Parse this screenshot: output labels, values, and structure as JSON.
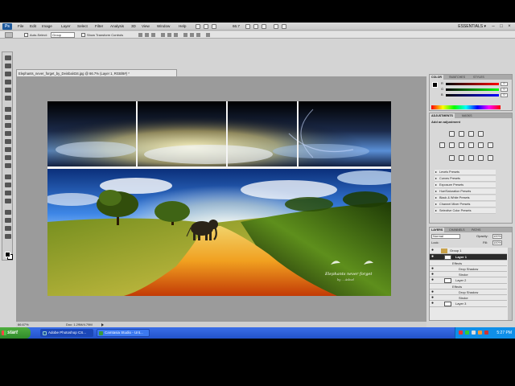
{
  "app": {
    "logo_text": "Ps",
    "menu": [
      "File",
      "Edit",
      "Image",
      "Layer",
      "Select",
      "Filter",
      "Analysis",
      "3D",
      "View",
      "Window",
      "Help"
    ],
    "zoom_label": "66.7",
    "workspace_label": "ESSENTIALS ▾",
    "window_controls": [
      "–",
      "□",
      "×"
    ]
  },
  "options": {
    "auto_select_label": "Auto-Select:",
    "auto_select_value": "Group",
    "show_transform_label": "Show Transform Controls"
  },
  "document": {
    "tab_title": "Elephants_never_forget_by_Deinbal434.jpg @ 66.7% (Layer 1, RGB/8#) *",
    "watermark_line1": "Elephants never forget",
    "watermark_line2": "by ... Asbud",
    "status_zoom": "66.67%",
    "status_doc": "Doc: 1.29M/4.79M"
  },
  "panels": {
    "color": {
      "tabs": [
        "COLOR",
        "SWATCHES",
        "STYLES"
      ],
      "sliders": [
        {
          "label": "R",
          "value": "0",
          "color": "#e03030"
        },
        {
          "label": "G",
          "value": "0",
          "color": "#30c030"
        },
        {
          "label": "B",
          "value": "0",
          "color": "#3050e0"
        }
      ]
    },
    "adjustments": {
      "tabs": [
        "ADJUSTMENTS",
        "MASKS"
      ],
      "heading": "Add an adjustment",
      "presets": [
        "Levels Presets",
        "Curves Presets",
        "Exposure Presets",
        "Hue/Saturation Presets",
        "Black & White Presets",
        "Channel Mixer Presets",
        "Selective Color Presets"
      ]
    },
    "layers": {
      "tabs": [
        "LAYERS",
        "CHANNELS",
        "PATHS"
      ],
      "blend_mode": "Normal",
      "opacity_label": "Opacity:",
      "opacity_value": "100%",
      "lock_label": "Lock:",
      "fill_label": "Fill:",
      "fill_value": "100%",
      "rows": [
        {
          "name": "Group 1",
          "kind": "group"
        },
        {
          "name": "Layer 1",
          "kind": "layer",
          "selected": true
        },
        {
          "name": "Effects",
          "kind": "effects"
        },
        {
          "name": "Drop Shadow",
          "kind": "effect"
        },
        {
          "name": "Stroke",
          "kind": "effect"
        },
        {
          "name": "Layer 2",
          "kind": "layer"
        },
        {
          "name": "Effects",
          "kind": "effects"
        },
        {
          "name": "Drop Shadow",
          "kind": "effect"
        },
        {
          "name": "Stroke",
          "kind": "effect"
        },
        {
          "name": "Layer 3",
          "kind": "layer"
        }
      ]
    }
  },
  "taskbar": {
    "start_label": "start",
    "items": [
      {
        "label": "Adobe Photoshop CS...",
        "active": true
      },
      {
        "label": "Camtasia Studio - Unt...",
        "active": false
      }
    ],
    "clock": "5:27 PM"
  },
  "colors": {
    "accent": "#1f5a9c",
    "taskbar": "#2252c9",
    "start": "#2f8a2a"
  }
}
